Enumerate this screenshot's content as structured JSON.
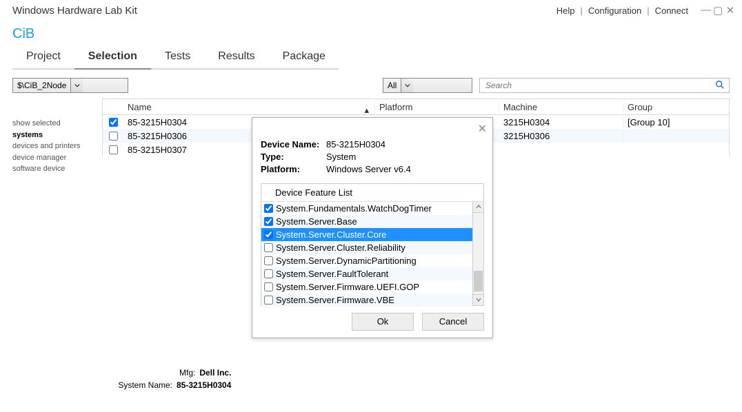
{
  "window": {
    "title": "Windows Hardware Lab Kit"
  },
  "header_links": {
    "help": "Help",
    "config": "Configuration",
    "connect": "Connect"
  },
  "subtitle": "CiB",
  "tabs": {
    "project": "Project",
    "selection": "Selection",
    "tests": "Tests",
    "results": "Results",
    "package": "Package"
  },
  "toolbar": {
    "scope_dropdown": "$\\CiB_2Node",
    "filter_dropdown": "All",
    "search_placeholder": "Search"
  },
  "left_filters": {
    "line1": "show selected",
    "line2": "systems",
    "line3": "devices and printers",
    "line4": "device manager",
    "line5": "software device"
  },
  "columns": {
    "name": "Name",
    "platform": "Platform",
    "machine": "Machine",
    "group": "Group"
  },
  "rows": [
    {
      "checked": true,
      "name": "85-3215H0304",
      "platform": "",
      "machine": "3215H0304",
      "group": "[Group 10]"
    },
    {
      "checked": false,
      "name": "85-3215H0306",
      "platform": "",
      "machine": "3215H0306",
      "group": ""
    },
    {
      "checked": false,
      "name": "85-3215H0307",
      "platform": "",
      "machine": "",
      "group": ""
    }
  ],
  "footer": {
    "mfg_label": "Mfg:",
    "mfg": "Dell Inc.",
    "sys_label": "System Name:",
    "sys": "85-3215H0304"
  },
  "modal": {
    "dev_label": "Device Name:",
    "dev": "85-3215H0304",
    "type_label": "Type:",
    "type": "System",
    "plat_label": "Platform:",
    "plat": "Windows Server v6.4",
    "list_title": "Device Feature List",
    "features": [
      {
        "checked": true,
        "hl": false,
        "label": "System.Fundamentals.WatchDogTimer"
      },
      {
        "checked": true,
        "hl": false,
        "label": "System.Server.Base"
      },
      {
        "checked": true,
        "hl": true,
        "label": "System.Server.Cluster.Core"
      },
      {
        "checked": false,
        "hl": false,
        "label": "System.Server.Cluster.Reliability"
      },
      {
        "checked": false,
        "hl": false,
        "label": "System.Server.DynamicPartitioning"
      },
      {
        "checked": false,
        "hl": false,
        "label": "System.Server.FaultTolerant"
      },
      {
        "checked": false,
        "hl": false,
        "label": "System.Server.Firmware.UEFI.GOP"
      },
      {
        "checked": false,
        "hl": false,
        "label": "System.Server.Firmware.VBE"
      }
    ],
    "ok": "Ok",
    "cancel": "Cancel"
  }
}
